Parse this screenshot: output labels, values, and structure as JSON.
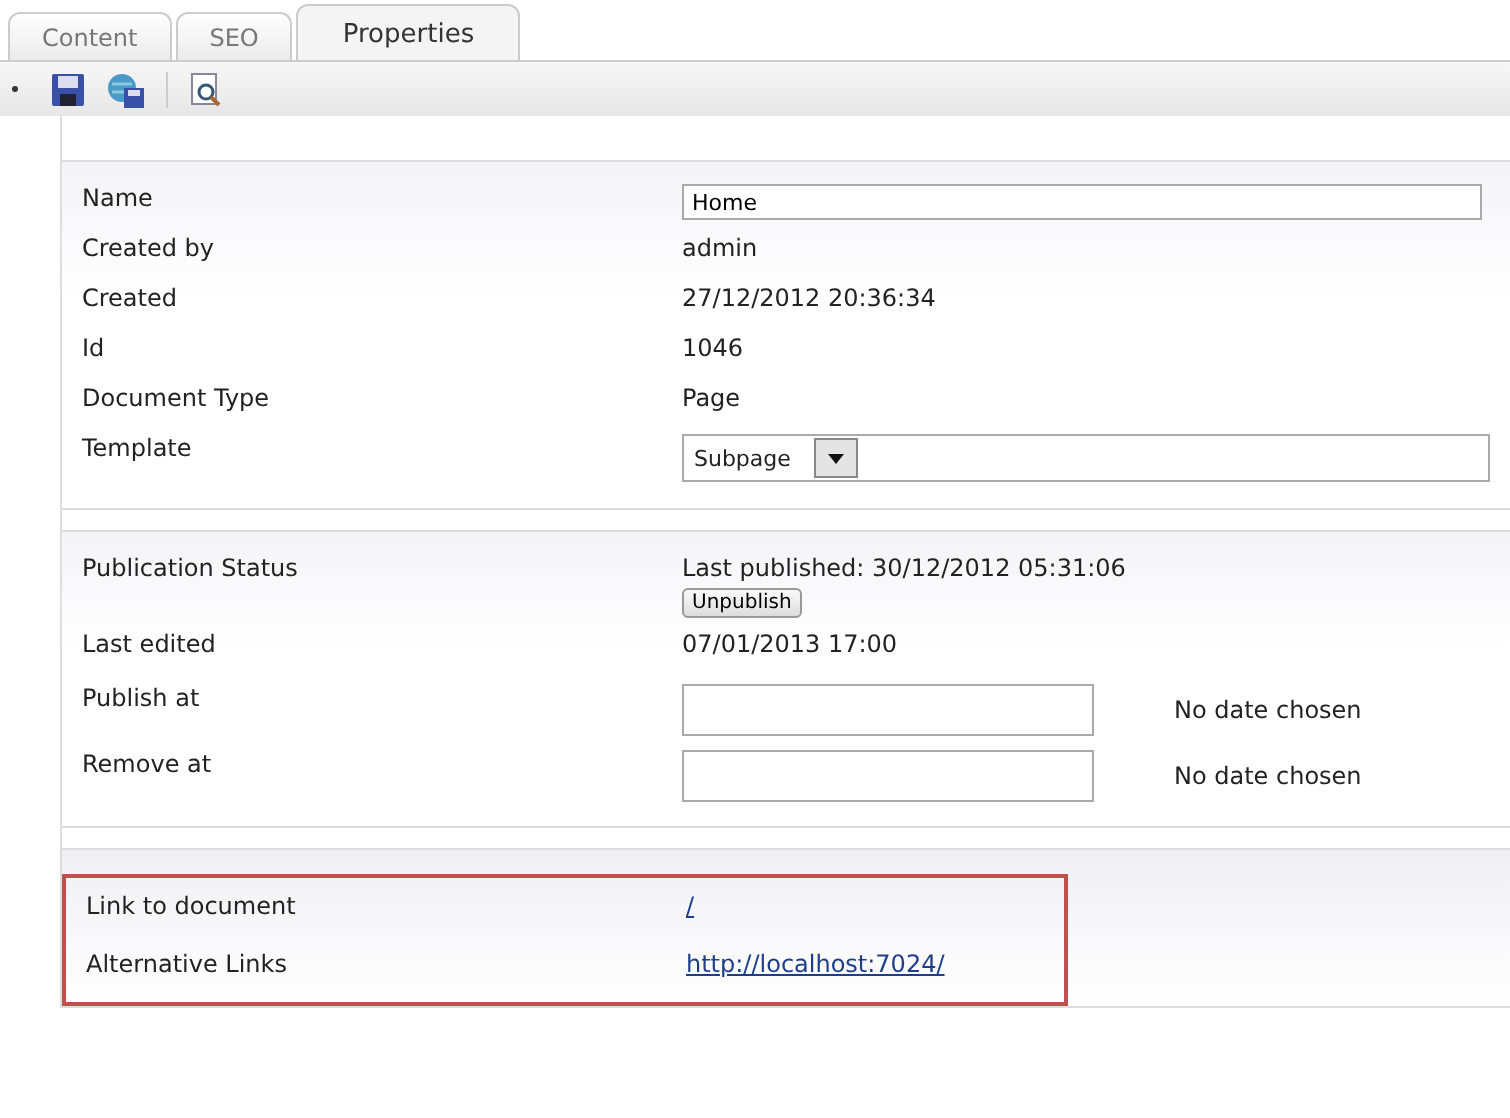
{
  "tabs": [
    {
      "label": "Content",
      "selected": false
    },
    {
      "label": "SEO",
      "selected": false
    },
    {
      "label": "Properties",
      "selected": true
    }
  ],
  "toolbar": {
    "buttons": [
      {
        "kind": "save"
      },
      {
        "kind": "publish"
      },
      {
        "kind": "preview"
      }
    ]
  },
  "panels": [
    {
      "highlighted": false,
      "rows": [
        {
          "kind": "input",
          "label": "Name",
          "value": "Home"
        },
        {
          "kind": "text",
          "label": "Created by",
          "value": "admin"
        },
        {
          "kind": "text",
          "label": "Created",
          "value": "27/12/2012 20:36:34"
        },
        {
          "kind": "text",
          "label": "Id",
          "value": "1046"
        },
        {
          "kind": "text",
          "label": "Document Type",
          "value": "Page"
        },
        {
          "kind": "select",
          "label": "Template",
          "value": "Subpage"
        }
      ]
    },
    {
      "highlighted": false,
      "rows": [
        {
          "kind": "status",
          "label": "Publication Status",
          "value": "Last published: 30/12/2012 05:31:06",
          "button": "Unpublish"
        },
        {
          "kind": "text",
          "label": "Last edited",
          "value": "07/01/2013 17:00"
        },
        {
          "kind": "date",
          "label": "Publish at",
          "note": "No date chosen"
        },
        {
          "kind": "date",
          "label": "Remove at",
          "note": "No date chosen"
        }
      ]
    },
    {
      "highlighted": true,
      "rows": [
        {
          "kind": "link",
          "label": "Link to document",
          "value": "/"
        },
        {
          "kind": "link",
          "label": "Alternative Links",
          "value": "http://localhost:7024/"
        }
      ]
    }
  ]
}
